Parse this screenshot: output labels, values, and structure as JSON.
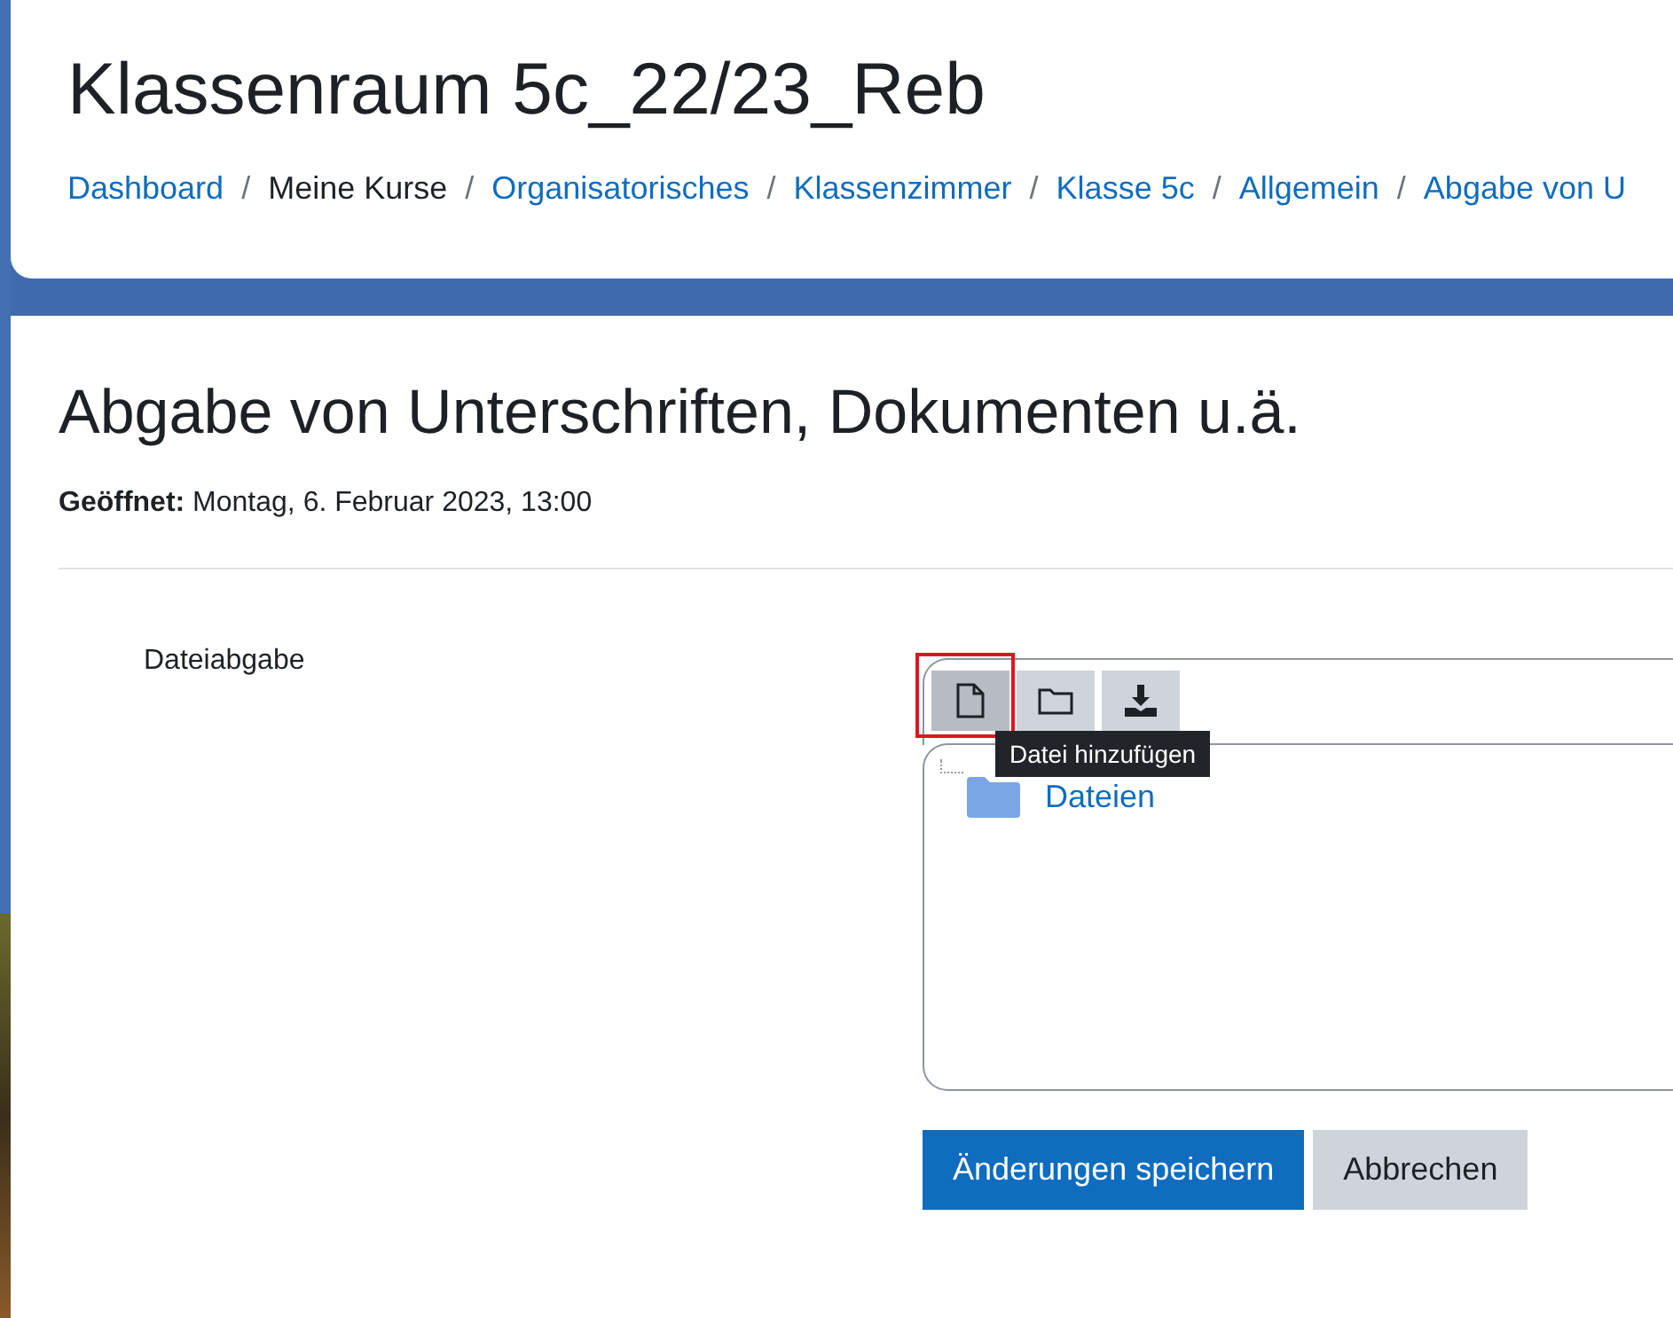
{
  "header": {
    "title": "Klassenraum 5c_22/23_Reb",
    "breadcrumb": {
      "separator": "/",
      "items": [
        {
          "label": "Dashboard",
          "link": true
        },
        {
          "label": "Meine Kurse",
          "link": false
        },
        {
          "label": "Organisatorisches",
          "link": true
        },
        {
          "label": "Klassenzimmer",
          "link": true
        },
        {
          "label": "Klasse 5c",
          "link": true
        },
        {
          "label": "Allgemein",
          "link": true
        },
        {
          "label": "Abgabe von U",
          "link": true
        }
      ]
    }
  },
  "activity": {
    "title": "Abgabe von Unterschriften, Dokumenten u.ä.",
    "opened": "**Geöffnet:** Montag, 6. Februar 2023, 13:00"
  },
  "form": {
    "label": "Dateiabgabe",
    "toolbar": [
      {
        "kind": "add-file",
        "highlighted": true,
        "tooltip": "Datei hinzufügen"
      },
      {
        "kind": "folder",
        "highlighted": false
      },
      {
        "kind": "download",
        "highlighted": false
      }
    ],
    "folders": [
      {
        "name": "Dateien"
      }
    ],
    "buttons": [
      {
        "label": "Änderungen speichern",
        "kind": "primary"
      },
      {
        "label": "Abbrechen",
        "kind": "secondary"
      }
    ]
  }
}
